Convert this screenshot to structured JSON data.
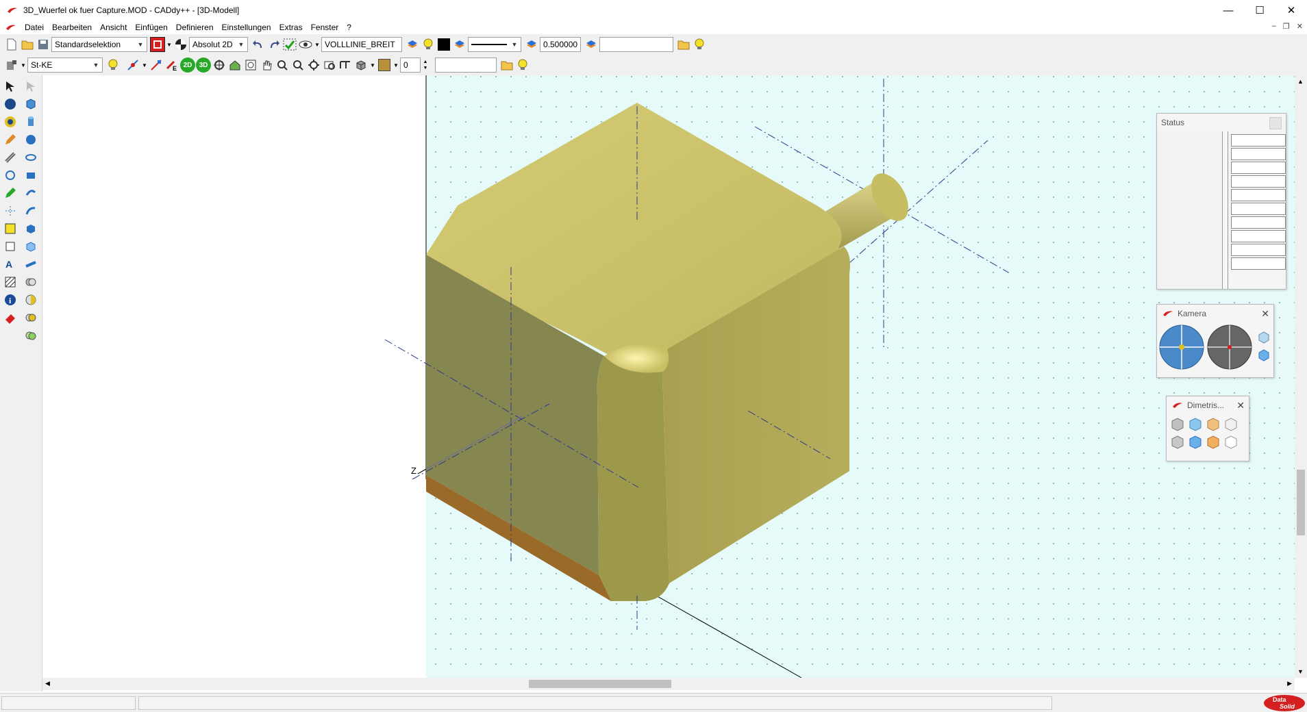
{
  "window": {
    "title": "3D_Wuerfel ok fuer Capture.MOD  -  CADdy++ - [3D-Modell]",
    "controls": [
      "—",
      "☐",
      "✕"
    ]
  },
  "menu": {
    "items": [
      "Datei",
      "Bearbeiten",
      "Ansicht",
      "Einfügen",
      "Definieren",
      "Einstellungen",
      "Extras",
      "Fenster",
      "?"
    ],
    "mdi_controls": [
      "–",
      "❐",
      "✕"
    ]
  },
  "toolbar1": {
    "selection_mode": "Standardselektion",
    "coord_mode": "Absolut 2D",
    "linetype": "VOLLLINIE_BREIT",
    "linewidth": "0.500000",
    "layer_field": ""
  },
  "toolbar2": {
    "layer_name": "St-KE",
    "btn_2d": "2D",
    "btn_3d": "3D",
    "number_value": "0",
    "text_field": ""
  },
  "viewport": {
    "axis_label": "Z",
    "background_color": "#e6fafa",
    "solid_color": "#c8c068"
  },
  "panels": {
    "status": {
      "title": "Status",
      "rows": 10
    },
    "kamera": {
      "title": "Kamera"
    },
    "dimetric": {
      "title": "Dimetris..."
    }
  },
  "statusbar": {
    "logo_text_top": "Data",
    "logo_text_bottom": "Solid"
  },
  "colors": {
    "accent_red": "#d42020",
    "ribbon": "#f0f0f0"
  }
}
